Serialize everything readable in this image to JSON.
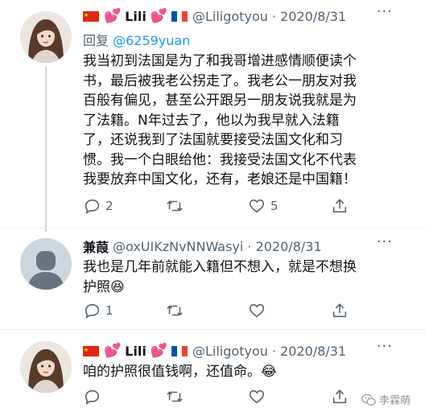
{
  "tweets": [
    {
      "flag_left": "china-flag-icon",
      "heart": "💕",
      "name": "Lili",
      "flag_right": "france-flag-icon",
      "handle": "@Liligotyou · 2020/8/31",
      "more": "···",
      "reply_prefix": "回复",
      "reply_mention": "@6259yuan",
      "lines": [
        "我当初到法国是为了和我哥增进感情顺便读个",
        "书，最后被我老公拐走了。我老公一朋友对我",
        "百般有偏见，甚至公开跟另一朋友说我就是为",
        "了法籍。N年过去了，他以为我早就入法籍",
        "了，还说我到了法国就要接受法国文化和习",
        "惯。我一个白眼给他：我接受法国文化不代表",
        "我要放弃中国文化，还有，老娘还是中国籍！"
      ],
      "reply_count": "2",
      "retweet_count": "",
      "like_count": "5"
    },
    {
      "name": "兼葭",
      "handle": "@oxUIKzNvNNWasyi · 2020/8/31",
      "more": "···",
      "lines": [
        "我也是几年前就能入籍但不想入，就是不想换",
        "护照😆"
      ],
      "reply_count": "1",
      "retweet_count": "",
      "like_count": ""
    },
    {
      "flag_left": "china-flag-icon",
      "heart": "💕",
      "name": "Lili",
      "flag_right": "france-flag-icon",
      "handle": "@Liligotyou · 2020/8/31",
      "more": "···",
      "lines": [
        "咱的护照很值钱啊，还值命。😂"
      ],
      "reply_count": "",
      "retweet_count": "",
      "like_count": ""
    }
  ],
  "watermark": {
    "icon": "wechat-icon",
    "text": "李霖萌"
  },
  "colors": {
    "text": "#0f1419",
    "muted": "#536471",
    "link": "#1d9bf0",
    "divider": "#eff3f4",
    "thread_line": "#cfd9de"
  }
}
